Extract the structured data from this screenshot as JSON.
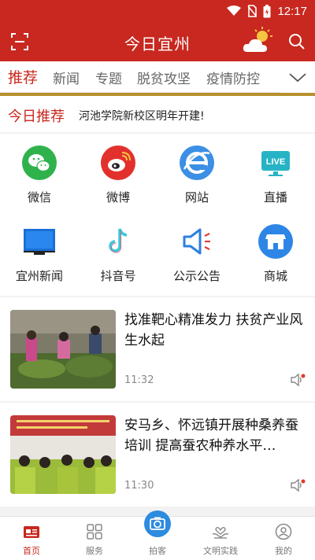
{
  "status": {
    "time": "12:17"
  },
  "header": {
    "title": "今日宜州"
  },
  "tabs": [
    {
      "label": "推荐",
      "active": true
    },
    {
      "label": "新闻"
    },
    {
      "label": "专题"
    },
    {
      "label": "脱贫攻坚"
    },
    {
      "label": "疫情防控"
    }
  ],
  "banner": {
    "title": "今日推荐",
    "headline": "河池学院新校区明年开建!"
  },
  "grid": [
    {
      "label": "微信",
      "icon": "wechat-icon"
    },
    {
      "label": "微博",
      "icon": "weibo-icon"
    },
    {
      "label": "网站",
      "icon": "browser-icon"
    },
    {
      "label": "直播",
      "icon": "live-tv-icon"
    },
    {
      "label": "宜州新闻",
      "icon": "tv-icon"
    },
    {
      "label": "抖音号",
      "icon": "douyin-icon"
    },
    {
      "label": "公示公告",
      "icon": "megaphone-icon"
    },
    {
      "label": "商城",
      "icon": "shop-icon"
    }
  ],
  "news": [
    {
      "title": "找准靶心精准发力 扶贫产业风生水起",
      "time": "11:32"
    },
    {
      "title": "安马乡、怀远镇开展种桑养蚕培训 提高蚕农种养水平…",
      "time": "11:30"
    }
  ],
  "bottom_nav": [
    {
      "label": "首页",
      "icon": "home-icon",
      "active": true
    },
    {
      "label": "服务",
      "icon": "grid-icon"
    },
    {
      "label": "拍客",
      "icon": "camera-icon"
    },
    {
      "label": "文明实践",
      "icon": "hands-heart-icon"
    },
    {
      "label": "我的",
      "icon": "user-icon"
    }
  ],
  "colors": {
    "brand_red": "#c8281f",
    "gold": "#b7912e",
    "camera_blue": "#2d8be0"
  }
}
